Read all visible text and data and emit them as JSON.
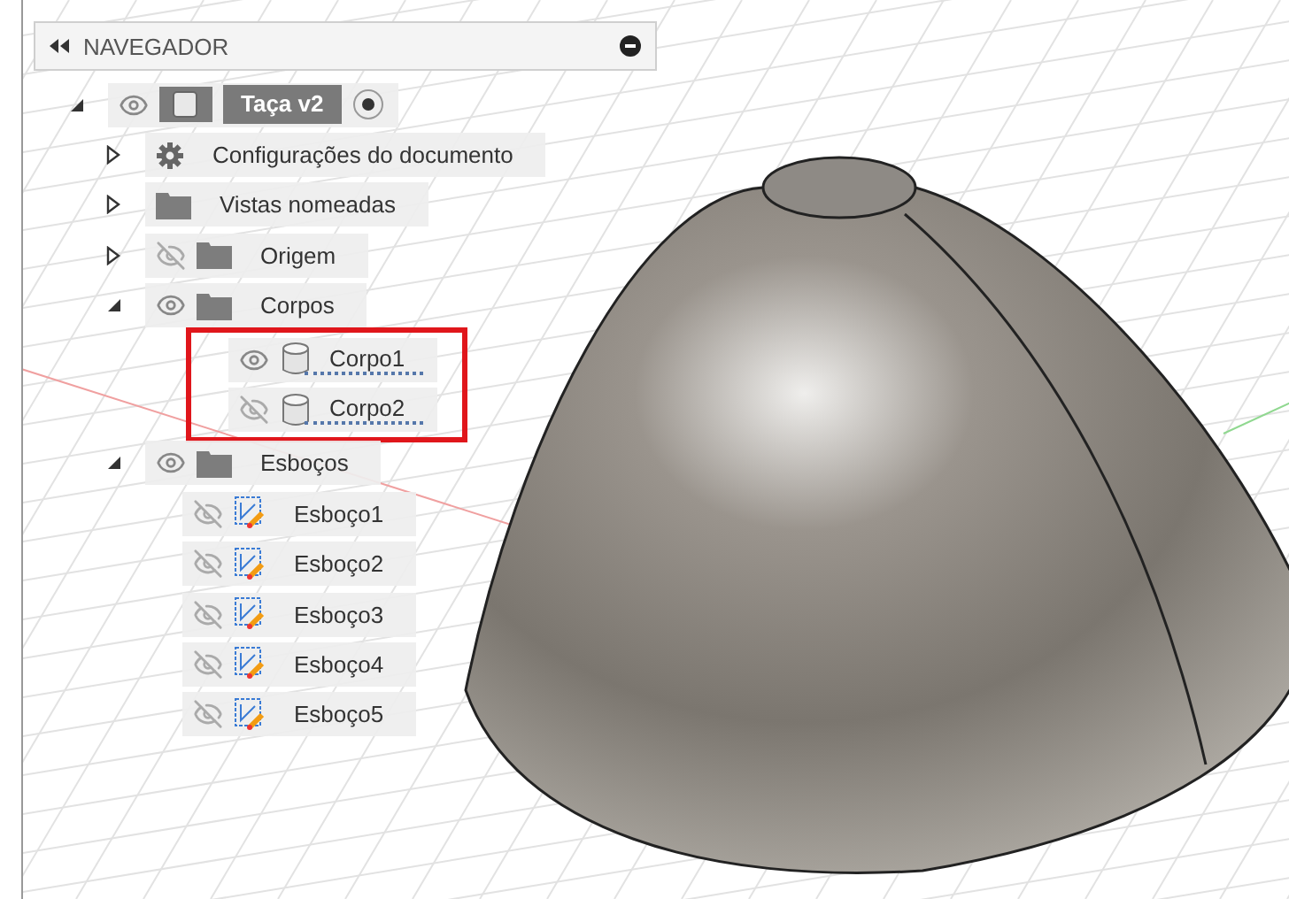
{
  "browser": {
    "title": "NAVEGADOR",
    "tree": [
      {
        "kind": "component",
        "label": "Taça v2",
        "expanded": true,
        "visible": true,
        "active": true,
        "children": [
          {
            "kind": "settings",
            "label": "Configurações do documento",
            "expanded": false
          },
          {
            "kind": "folder",
            "label": "Vistas nomeadas",
            "expanded": false
          },
          {
            "kind": "folder",
            "label": "Origem",
            "expanded": false,
            "visible": false
          },
          {
            "kind": "folder",
            "label": "Corpos",
            "expanded": true,
            "visible": true,
            "children_highlighted": true,
            "children": [
              {
                "kind": "body",
                "label": "Corpo1",
                "visible": true
              },
              {
                "kind": "body",
                "label": "Corpo2",
                "visible": false
              }
            ]
          },
          {
            "kind": "folder",
            "label": "Esboços",
            "expanded": true,
            "visible": true,
            "children": [
              {
                "kind": "sketch",
                "label": "Esboço1",
                "visible": false
              },
              {
                "kind": "sketch",
                "label": "Esboço2",
                "visible": false
              },
              {
                "kind": "sketch",
                "label": "Esboço3",
                "visible": false
              },
              {
                "kind": "sketch",
                "label": "Esboço4",
                "visible": false
              },
              {
                "kind": "sketch",
                "label": "Esboço5",
                "visible": false
              }
            ]
          }
        ]
      }
    ]
  }
}
